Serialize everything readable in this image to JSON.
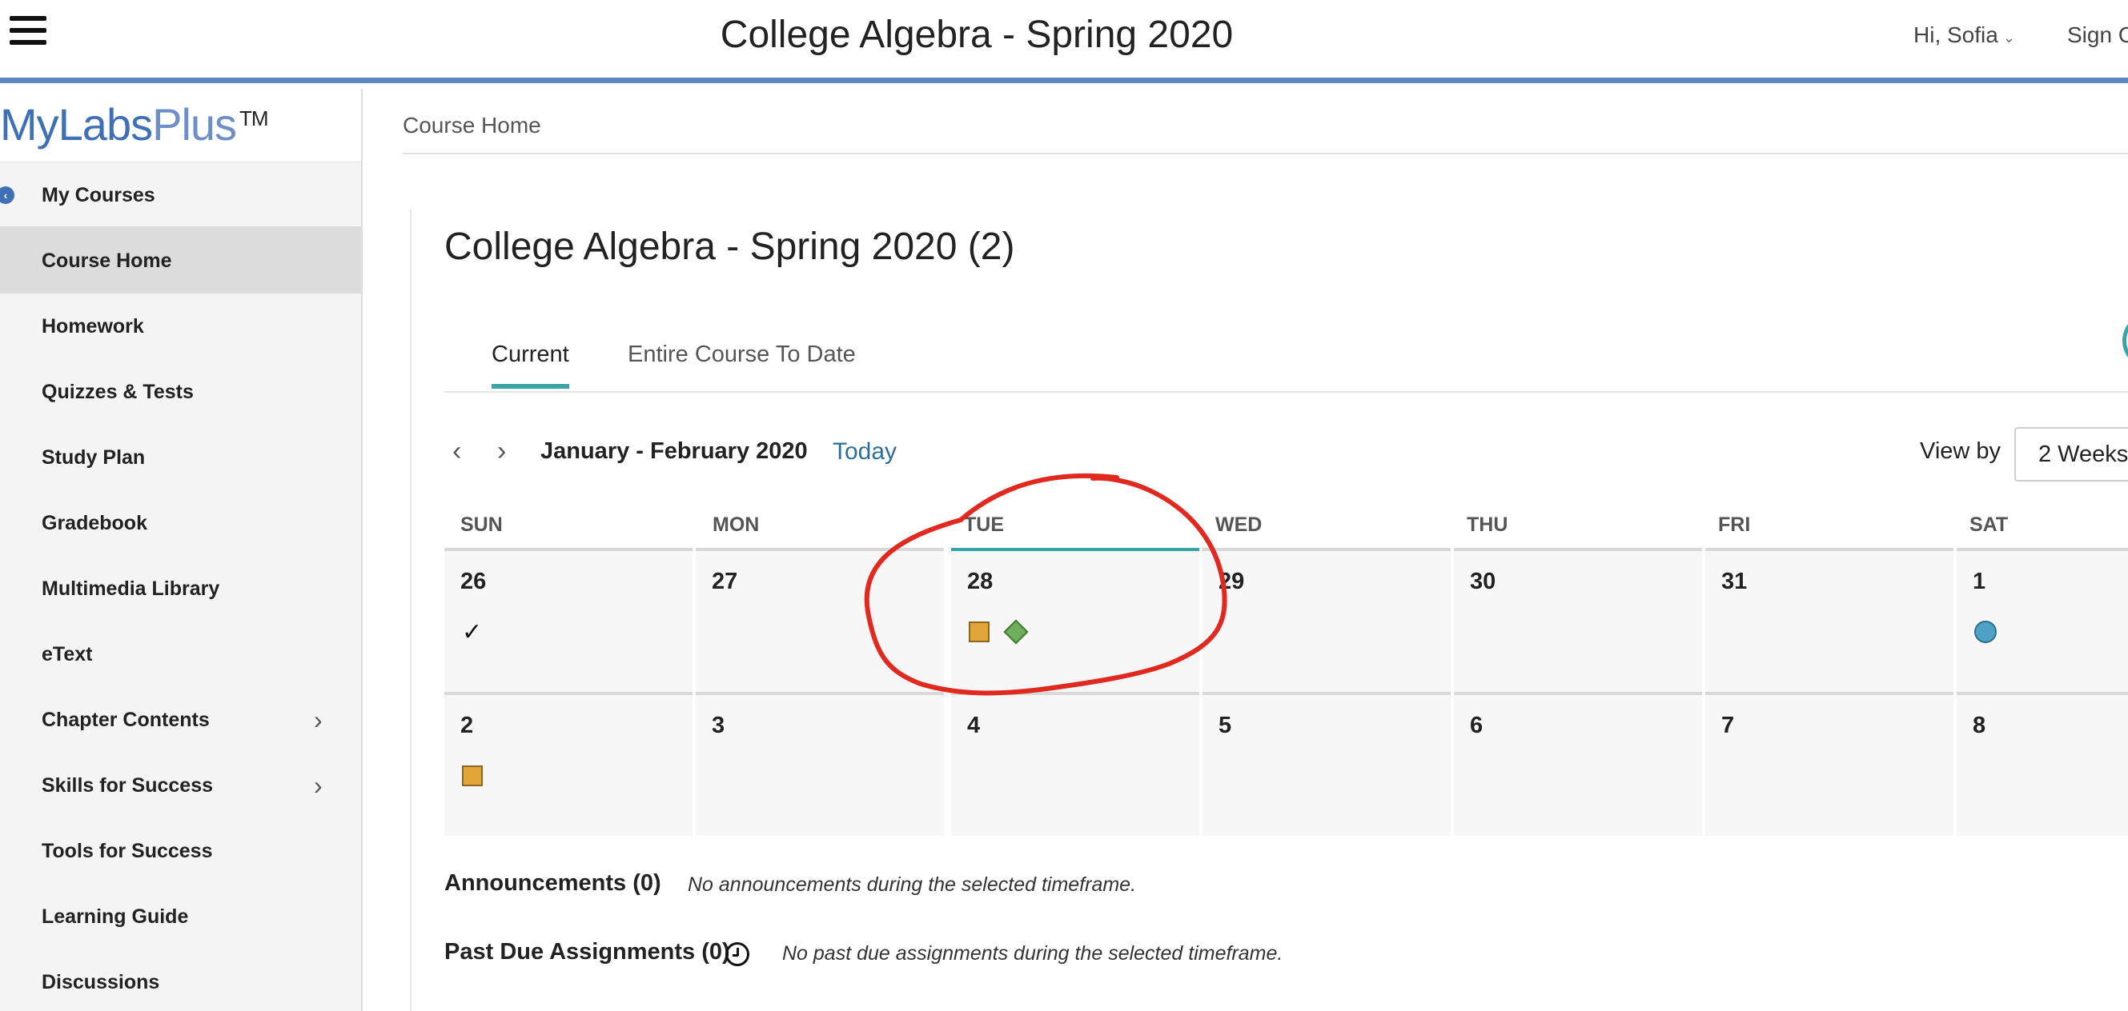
{
  "header": {
    "title": "College Algebra - Spring 2020",
    "greeting": "Hi, Sofia",
    "greeting_chevron": "⌄",
    "sign_out": "Sign Out"
  },
  "sidebar": {
    "logo_main": "MyLabs",
    "logo_plus": "Plus",
    "logo_tm": "TM",
    "items": [
      {
        "label": "My Courses"
      },
      {
        "label": "Course Home"
      },
      {
        "label": "Homework"
      },
      {
        "label": "Quizzes & Tests"
      },
      {
        "label": "Study Plan"
      },
      {
        "label": "Gradebook"
      },
      {
        "label": "Multimedia Library"
      },
      {
        "label": "eText"
      },
      {
        "label": "Chapter Contents"
      },
      {
        "label": "Skills for Success"
      },
      {
        "label": "Tools for Success"
      },
      {
        "label": "Learning Guide"
      },
      {
        "label": "Discussions"
      }
    ]
  },
  "main": {
    "breadcrumb": "Course Home",
    "course_title": "College Algebra - Spring 2020 (2)",
    "tabs": [
      {
        "label": "Current"
      },
      {
        "label": "Entire Course To Date"
      }
    ],
    "calendar": {
      "range": "January - February 2020",
      "today_label": "Today",
      "view_by_label": "View by",
      "view_by_value": "2 Weeks",
      "day_headers": [
        "SUN",
        "MON",
        "TUE",
        "WED",
        "THU",
        "FRI",
        "SAT"
      ],
      "week1": [
        "26",
        "27",
        "28",
        "29",
        "30",
        "31",
        "1"
      ],
      "week2": [
        "2",
        "3",
        "4",
        "5",
        "6",
        "7",
        "8"
      ],
      "markers": {
        "check_glyph": "✓",
        "legend_icons": [
          "check-icon",
          "square-icon",
          "diamond-icon",
          "circle-icon"
        ],
        "colors": {
          "square": "#e2a53a",
          "diamond": "#6fae5a",
          "circle": "#4ea2c5",
          "accent": "#3aa3a6",
          "annotation": "#e02a20"
        }
      }
    },
    "announcements": {
      "title": "Announcements (0)",
      "note": "No announcements during the selected timeframe."
    },
    "past_due": {
      "title": "Past Due Assignments (0)",
      "note": "No past due assignments during the selected timeframe."
    }
  }
}
